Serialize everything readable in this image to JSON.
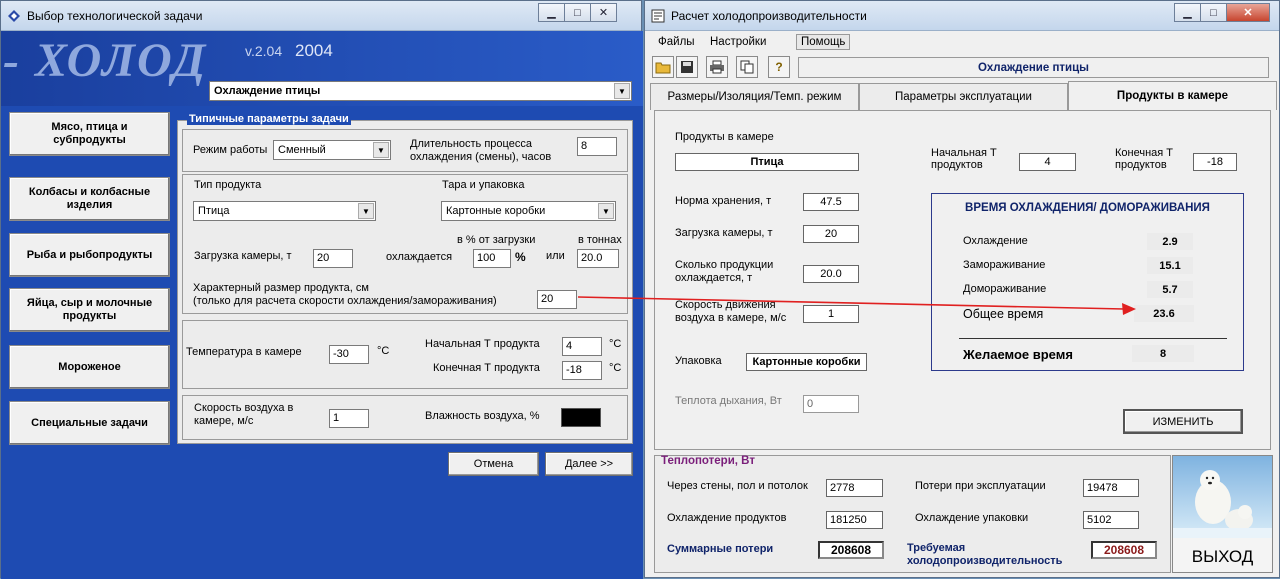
{
  "left_window": {
    "title": "Выбор технологической задачи",
    "logo": "- ХОЛОД",
    "version": "v.2.04",
    "year": "2004",
    "task_select": "Охлаждение птицы",
    "categories": [
      "Мясо, птица и субпродукты",
      "Колбасы и колбасные изделия",
      "Рыба и рыбопродукты",
      "Яйца, сыр и молочные продукты",
      "Мороженое",
      "Специальные задачи"
    ],
    "params_title": "Типичные параметры задачи",
    "mode_label": "Режим работы",
    "mode_value": "Сменный",
    "duration_label": "Длительность процесса охлаждения (смены), часов",
    "duration_value": "8",
    "product_type_label": "Тип продукта",
    "product_type_value": "Птица",
    "package_label": "Тара и упаковка",
    "package_value": "Картонные коробки",
    "load_label": "Загрузка камеры, т",
    "load_value": "20",
    "percent_header": "в % от загрузки",
    "tons_header": "в тоннах",
    "cooled_label": "охлаждается",
    "percent_value": "100",
    "percent_unit": "%",
    "or_label": "или",
    "tons_value": "20.0",
    "size_label": "Характерный размер продукта, см",
    "size_note": "(только для расчета скорости охлаждения/замораживания)",
    "size_value": "20",
    "room_temp_label": "Температура в камере",
    "room_temp_value": "-30",
    "room_temp_unit": "°C",
    "start_t_label": "Начальная Т продукта",
    "start_t_value": "4",
    "start_t_unit": "°C",
    "end_t_label": "Конечная Т продукта",
    "end_t_value": "-18",
    "end_t_unit": "°C",
    "air_speed_label": "Скорость воздуха в камере, м/с",
    "air_speed_value": "1",
    "humidity_label": "Влажность воздуха, %",
    "cancel_label": "Отмена",
    "next_label": "Далее >>"
  },
  "right_window": {
    "title": "Расчет холодопроизводительности",
    "menu": [
      "Файлы",
      "Настройки",
      "Помощь"
    ],
    "toolbar_caption": "Охлаждение птицы",
    "tabs": [
      "Размеры/Изоляция/Темп. режим",
      "Параметры эксплуатации",
      "Продукты в камере"
    ],
    "products_label": "Продукты в камере",
    "products_value": "Птица",
    "start_t_label": "Начальная Т продуктов",
    "start_t_value": "4",
    "end_t_label": "Конечная Т продуктов",
    "end_t_value": "-18",
    "storage_label": "Норма хранения, т",
    "storage_value": "47.5",
    "load_label": "Загрузка камеры, т",
    "load_value": "20",
    "cooled_label": "Сколько продукции охлаждается, т",
    "cooled_value": "20.0",
    "air_label": "Скорость движения воздуха в камере, м/с",
    "air_value": "1",
    "package_label": "Упаковка",
    "package_value": "Картонные коробки",
    "breath_label": "Теплота дыхания, Вт",
    "breath_value": "0",
    "results_title": "ВРЕМЯ ОХЛАЖДЕНИЯ/ ДОМОРАЖИВАНИЯ",
    "results": [
      {
        "label": "Охлаждение",
        "value": "2.9"
      },
      {
        "label": "Замораживание",
        "value": "15.1"
      },
      {
        "label": "Домораживание",
        "value": "5.7"
      },
      {
        "label": "Общее время",
        "value": "23.6"
      }
    ],
    "desired_label": "Желаемое время",
    "desired_value": "8",
    "change_label": "ИЗМЕНИТЬ",
    "losses_title": "Теплопотери, Вт",
    "walls_label": "Через стены, пол и потолок",
    "walls_value": "2778",
    "operation_label": "Потери при эксплуатации",
    "operation_value": "19478",
    "products_cool_label": "Охлаждение продуктов",
    "products_cool_value": "181250",
    "package_cool_label": "Охлаждение упаковки",
    "package_cool_value": "5102",
    "total_label": "Суммарные потери",
    "total_value": "208608",
    "required_label": "Требуемая холодопроизводительность",
    "required_value": "208608",
    "exit_label": "ВЫХОД"
  },
  "colors": {
    "accent_blue": "#1e4bb2",
    "arrow_red": "#e02020",
    "required_value_color": "#8b1a1a",
    "losses_title_color": "#7a1e7a"
  }
}
